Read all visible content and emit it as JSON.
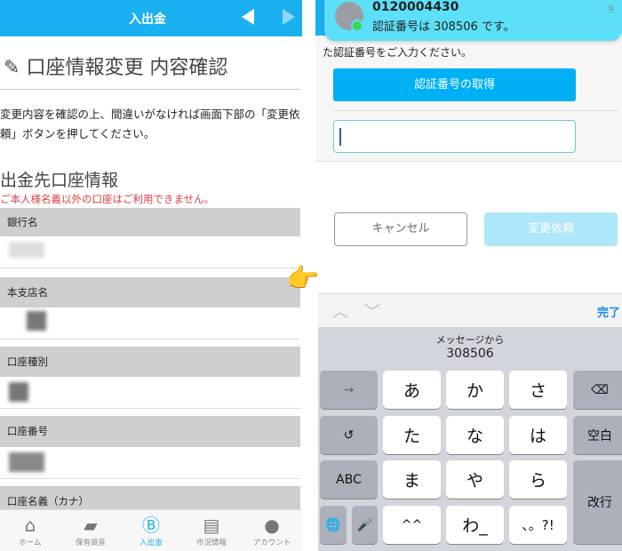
{
  "left": {
    "header": {
      "title": "入出金",
      "prev_icon": "triangle-left",
      "next_icon": "triangle-right",
      "color": "#1ab0f0"
    },
    "page_title": "口座情報変更 内容確認",
    "description": "変更内容を確認の上、間違いがなければ画面下部の「変更依頼」ボタンを押してください。",
    "section_title": "出金先口座情報",
    "warning": "ご本人様名義以外の口座はご利用できません。",
    "fields": [
      {
        "label": "銀行名"
      },
      {
        "label": "本支店名"
      },
      {
        "label": "口座種別"
      },
      {
        "label": "口座番号"
      },
      {
        "label": "口座名義（カナ）"
      }
    ],
    "nav": [
      {
        "label": "ホーム",
        "icon": "home"
      },
      {
        "label": "保有資産",
        "icon": "wallet"
      },
      {
        "label": "入出金",
        "icon": "bitcoin-transfer",
        "active": true
      },
      {
        "label": "市況情報",
        "icon": "news"
      },
      {
        "label": "アカウント",
        "icon": "person"
      }
    ]
  },
  "right": {
    "notification": {
      "sender": "0120004430",
      "message": "認証番号は 308506 です。",
      "time": "今"
    },
    "instruction": "た認証番号をご入力ください。",
    "get_code_button": "認証番号の取得",
    "code_input": "",
    "cancel_button": "キャンセル",
    "request_button": "変更依頼",
    "keyboard": {
      "done": "完了",
      "suggestion_label": "メッセージから",
      "suggestion_code": "308506",
      "keys": {
        "arrow": "→",
        "undo": "↺",
        "abc": "ABC",
        "a": "あ",
        "ka": "か",
        "sa": "さ",
        "ta": "た",
        "na": "な",
        "ha": "は",
        "ma": "ま",
        "ya": "や",
        "ra": "ら",
        "emoji": "^^",
        "wa": "わ_",
        "punct": "、。?!",
        "space": "空白",
        "return": "改行",
        "delete": "⌫",
        "globe": "🌐",
        "mic": "🎤"
      }
    }
  }
}
